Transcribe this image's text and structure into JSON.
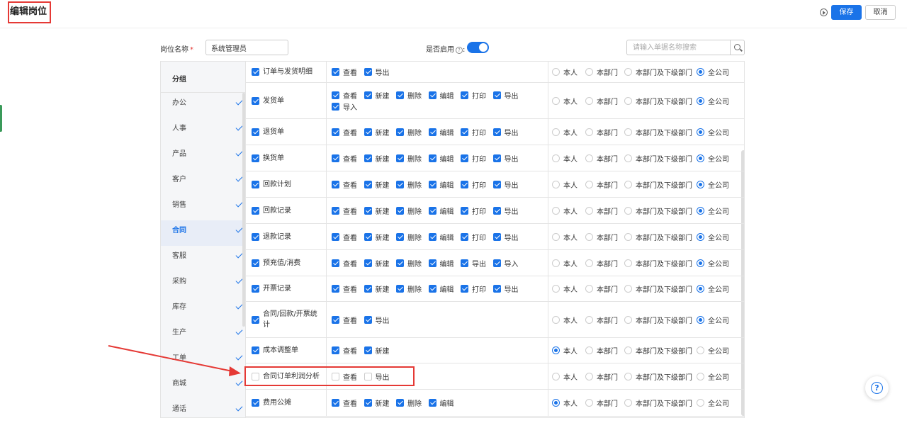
{
  "header": {
    "title": "编辑岗位",
    "save_label": "保存",
    "cancel_label": "取消"
  },
  "form": {
    "name_label": "岗位名称",
    "required_mark": "*",
    "name_value": "系统管理员",
    "enable_label": "是否启用",
    "enable_help": "?",
    "enable_colon": ":",
    "enabled": true,
    "search_placeholder": "请输入单据名称搜索"
  },
  "groups": {
    "header": "分组",
    "items": [
      {
        "label": "办公",
        "checked": true,
        "active": false
      },
      {
        "label": "人事",
        "checked": true,
        "active": false
      },
      {
        "label": "产品",
        "checked": true,
        "active": false
      },
      {
        "label": "客户",
        "checked": true,
        "active": false
      },
      {
        "label": "销售",
        "checked": true,
        "active": false
      },
      {
        "label": "合同",
        "checked": true,
        "active": true
      },
      {
        "label": "客服",
        "checked": true,
        "active": false
      },
      {
        "label": "采购",
        "checked": true,
        "active": false
      },
      {
        "label": "库存",
        "checked": true,
        "active": false
      },
      {
        "label": "生产",
        "checked": true,
        "active": false
      },
      {
        "label": "工单",
        "checked": true,
        "active": false
      },
      {
        "label": "商城",
        "checked": true,
        "active": false
      },
      {
        "label": "通话",
        "checked": true,
        "active": false
      }
    ]
  },
  "scope_labels": [
    "本人",
    "本部门",
    "本部门及下级部门",
    "全公司"
  ],
  "rows": [
    {
      "name": "订单与发货明细",
      "checked": true,
      "ops": [
        {
          "label": "查看",
          "on": true
        },
        {
          "label": "导出",
          "on": true
        }
      ],
      "scope": 3
    },
    {
      "name": "发货单",
      "checked": true,
      "ops": [
        {
          "label": "查看",
          "on": true
        },
        {
          "label": "新建",
          "on": true
        },
        {
          "label": "删除",
          "on": true
        },
        {
          "label": "编辑",
          "on": true
        },
        {
          "label": "打印",
          "on": true
        },
        {
          "label": "导出",
          "on": true
        },
        {
          "label": "导入",
          "on": true
        }
      ],
      "scope": 3
    },
    {
      "name": "退货单",
      "checked": true,
      "ops": [
        {
          "label": "查看",
          "on": true
        },
        {
          "label": "新建",
          "on": true
        },
        {
          "label": "删除",
          "on": true
        },
        {
          "label": "编辑",
          "on": true
        },
        {
          "label": "打印",
          "on": true
        },
        {
          "label": "导出",
          "on": true
        }
      ],
      "scope": 3
    },
    {
      "name": "换货单",
      "checked": true,
      "ops": [
        {
          "label": "查看",
          "on": true
        },
        {
          "label": "新建",
          "on": true
        },
        {
          "label": "删除",
          "on": true
        },
        {
          "label": "编辑",
          "on": true
        },
        {
          "label": "打印",
          "on": true
        },
        {
          "label": "导出",
          "on": true
        }
      ],
      "scope": 3
    },
    {
      "name": "回款计划",
      "checked": true,
      "ops": [
        {
          "label": "查看",
          "on": true
        },
        {
          "label": "新建",
          "on": true
        },
        {
          "label": "删除",
          "on": true
        },
        {
          "label": "编辑",
          "on": true
        },
        {
          "label": "打印",
          "on": true
        },
        {
          "label": "导出",
          "on": true
        }
      ],
      "scope": 3
    },
    {
      "name": "回款记录",
      "checked": true,
      "ops": [
        {
          "label": "查看",
          "on": true
        },
        {
          "label": "新建",
          "on": true
        },
        {
          "label": "删除",
          "on": true
        },
        {
          "label": "编辑",
          "on": true
        },
        {
          "label": "打印",
          "on": true
        },
        {
          "label": "导出",
          "on": true
        }
      ],
      "scope": 3
    },
    {
      "name": "退款记录",
      "checked": true,
      "ops": [
        {
          "label": "查看",
          "on": true
        },
        {
          "label": "新建",
          "on": true
        },
        {
          "label": "删除",
          "on": true
        },
        {
          "label": "编辑",
          "on": true
        },
        {
          "label": "打印",
          "on": true
        },
        {
          "label": "导出",
          "on": true
        }
      ],
      "scope": 3
    },
    {
      "name": "预充值/消费",
      "checked": true,
      "ops": [
        {
          "label": "查看",
          "on": true
        },
        {
          "label": "新建",
          "on": true
        },
        {
          "label": "删除",
          "on": true
        },
        {
          "label": "编辑",
          "on": true
        },
        {
          "label": "导出",
          "on": true
        },
        {
          "label": "导入",
          "on": true
        }
      ],
      "scope": 3
    },
    {
      "name": "开票记录",
      "checked": true,
      "ops": [
        {
          "label": "查看",
          "on": true
        },
        {
          "label": "新建",
          "on": true
        },
        {
          "label": "删除",
          "on": true
        },
        {
          "label": "编辑",
          "on": true
        },
        {
          "label": "打印",
          "on": true
        },
        {
          "label": "导出",
          "on": true
        }
      ],
      "scope": 3
    },
    {
      "name": "合同/回款/开票统计",
      "checked": true,
      "ops": [
        {
          "label": "查看",
          "on": true
        },
        {
          "label": "导出",
          "on": true
        }
      ],
      "scope": 3
    },
    {
      "name": "成本调整单",
      "checked": true,
      "ops": [
        {
          "label": "查看",
          "on": true
        },
        {
          "label": "新建",
          "on": true
        }
      ],
      "scope": 0
    },
    {
      "name": "合同订单利润分析",
      "checked": false,
      "ops": [
        {
          "label": "查看",
          "on": false
        },
        {
          "label": "导出",
          "on": false
        }
      ],
      "scope": -1
    },
    {
      "name": "费用公摊",
      "checked": true,
      "ops": [
        {
          "label": "查看",
          "on": true
        },
        {
          "label": "新建",
          "on": true
        },
        {
          "label": "删除",
          "on": true
        },
        {
          "label": "编辑",
          "on": true
        }
      ],
      "scope": 0
    }
  ],
  "colors": {
    "accent": "#1a73e8",
    "annotation": "#e53935"
  }
}
